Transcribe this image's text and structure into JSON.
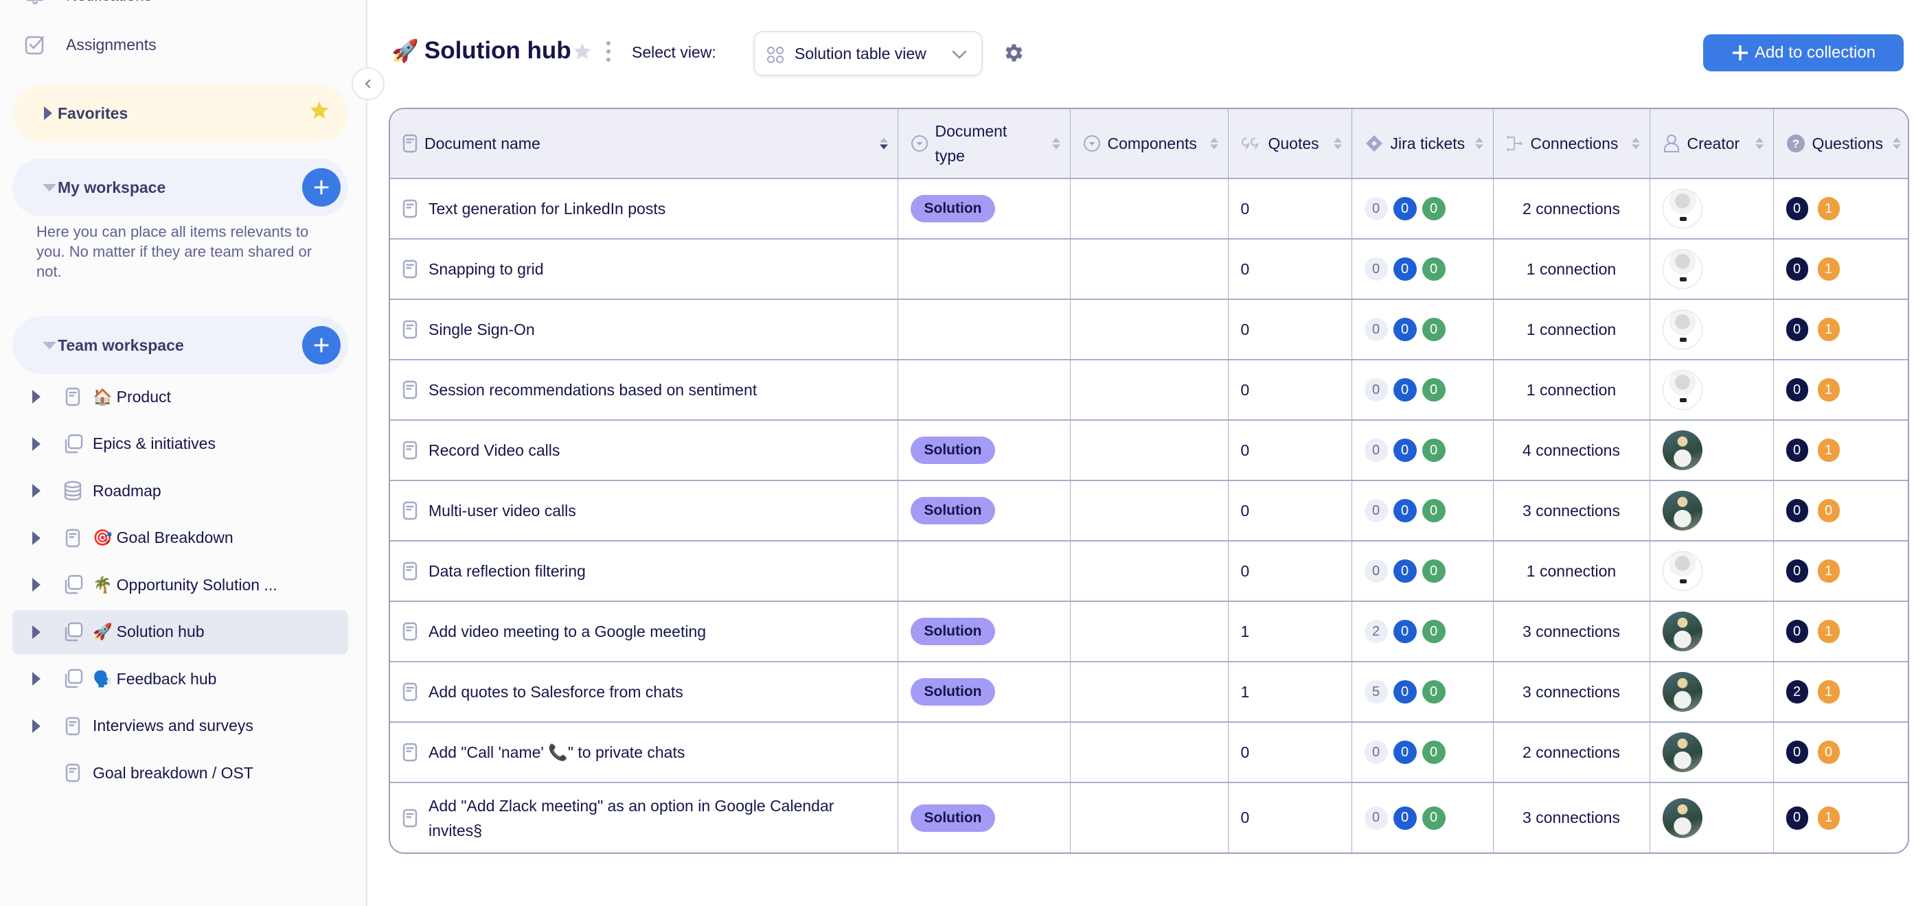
{
  "sidebar": {
    "nav": {
      "notifications": "Notifications",
      "assignments": "Assignments"
    },
    "favorites": {
      "label": "Favorites"
    },
    "my_workspace": {
      "label": "My workspace",
      "description": "Here you can place all items relevants to you. No matter if they are team shared or not."
    },
    "team_workspace": {
      "label": "Team workspace",
      "items": [
        {
          "label": "Product",
          "emoji": "🏠",
          "icon": "document-icon",
          "expandable": true
        },
        {
          "label": "Epics & initiatives",
          "emoji": "",
          "icon": "collection-icon",
          "expandable": true
        },
        {
          "label": "Roadmap",
          "emoji": "",
          "icon": "database-icon",
          "expandable": true
        },
        {
          "label": "Goal Breakdown",
          "emoji": "🎯",
          "icon": "document-icon",
          "expandable": true
        },
        {
          "label": "Opportunity Solution ...",
          "emoji": "🌴",
          "icon": "collection-icon",
          "expandable": true
        },
        {
          "label": "Solution hub",
          "emoji": "🚀",
          "icon": "collection-icon",
          "expandable": true,
          "active": true
        },
        {
          "label": "Feedback hub",
          "emoji": "🗣️",
          "icon": "collection-icon",
          "expandable": true
        },
        {
          "label": "Interviews and surveys",
          "emoji": "",
          "icon": "document-icon",
          "expandable": true
        },
        {
          "label": "Goal breakdown / OST",
          "emoji": "",
          "icon": "document-icon",
          "expandable": false
        }
      ]
    }
  },
  "header": {
    "emoji": "🚀",
    "title": "Solution hub",
    "select_view_label": "Select view:",
    "selected_view": "Solution table view",
    "add_button_label": "Add to collection"
  },
  "colors": {
    "primary": "#3a7ae5",
    "tag_solution": "#a49bf5",
    "jira_grey": "#eceef5",
    "jira_blue": "#1f5fd4",
    "jira_green": "#4ea56e",
    "question_navy": "#0f1547",
    "question_orange": "#ef9f3d"
  },
  "table": {
    "columns": [
      {
        "label": "Document name",
        "icon": "document-icon"
      },
      {
        "label": "Document type",
        "icon": "dropdown-circle-icon"
      },
      {
        "label": "Components",
        "icon": "dropdown-circle-icon"
      },
      {
        "label": "Quotes",
        "icon": "quote-icon"
      },
      {
        "label": "Jira tickets",
        "icon": "jira-icon"
      },
      {
        "label": "Connections",
        "icon": "connections-icon"
      },
      {
        "label": "Creator",
        "icon": "user-icon"
      },
      {
        "label": "Questions",
        "icon": "question-icon"
      }
    ],
    "rows": [
      {
        "name": "Text generation for LinkedIn posts",
        "type": "Solution",
        "components": "",
        "quotes": "0",
        "jira": [
          "0",
          "0",
          "0"
        ],
        "connections": "2 connections",
        "creator": "bw",
        "questions": [
          "0",
          "1"
        ]
      },
      {
        "name": "Snapping to grid",
        "type": "",
        "components": "",
        "quotes": "0",
        "jira": [
          "0",
          "0",
          "0"
        ],
        "connections": "1 connection",
        "creator": "bw",
        "questions": [
          "0",
          "1"
        ]
      },
      {
        "name": "Single Sign-On",
        "type": "",
        "components": "",
        "quotes": "0",
        "jira": [
          "0",
          "0",
          "0"
        ],
        "connections": "1 connection",
        "creator": "bw",
        "questions": [
          "0",
          "1"
        ]
      },
      {
        "name": "Session recommendations based on sentiment",
        "type": "",
        "components": "",
        "quotes": "0",
        "jira": [
          "0",
          "0",
          "0"
        ],
        "connections": "1 connection",
        "creator": "bw",
        "questions": [
          "0",
          "1"
        ]
      },
      {
        "name": "Record Video calls",
        "type": "Solution",
        "components": "",
        "quotes": "0",
        "jira": [
          "0",
          "0",
          "0"
        ],
        "connections": "4 connections",
        "creator": "color",
        "questions": [
          "0",
          "1"
        ]
      },
      {
        "name": "Multi-user video calls",
        "type": "Solution",
        "components": "",
        "quotes": "0",
        "jira": [
          "0",
          "0",
          "0"
        ],
        "connections": "3 connections",
        "creator": "color",
        "questions": [
          "0",
          "0"
        ]
      },
      {
        "name": "Data reflection filtering",
        "type": "",
        "components": "",
        "quotes": "0",
        "jira": [
          "0",
          "0",
          "0"
        ],
        "connections": "1 connection",
        "creator": "bw",
        "questions": [
          "0",
          "1"
        ]
      },
      {
        "name": "Add video meeting to a Google meeting",
        "type": "Solution",
        "components": "",
        "quotes": "1",
        "jira": [
          "2",
          "0",
          "0"
        ],
        "connections": "3 connections",
        "creator": "color",
        "questions": [
          "0",
          "1"
        ]
      },
      {
        "name": "Add quotes to Salesforce from chats",
        "type": "Solution",
        "components": "",
        "quotes": "1",
        "jira": [
          "5",
          "0",
          "0"
        ],
        "connections": "3 connections",
        "creator": "color",
        "questions": [
          "2",
          "1"
        ]
      },
      {
        "name": "Add \"Call 'name' 📞\" to private chats",
        "type": "",
        "components": "",
        "quotes": "0",
        "jira": [
          "0",
          "0",
          "0"
        ],
        "connections": "2 connections",
        "creator": "color",
        "questions": [
          "0",
          "0"
        ]
      },
      {
        "name": "Add \"Add Zlack meeting\" as an option in Google Calendar invites§",
        "type": "Solution",
        "components": "",
        "quotes": "0",
        "jira": [
          "0",
          "0",
          "0"
        ],
        "connections": "3 connections",
        "creator": "color",
        "questions": [
          "0",
          "1"
        ]
      }
    ]
  }
}
